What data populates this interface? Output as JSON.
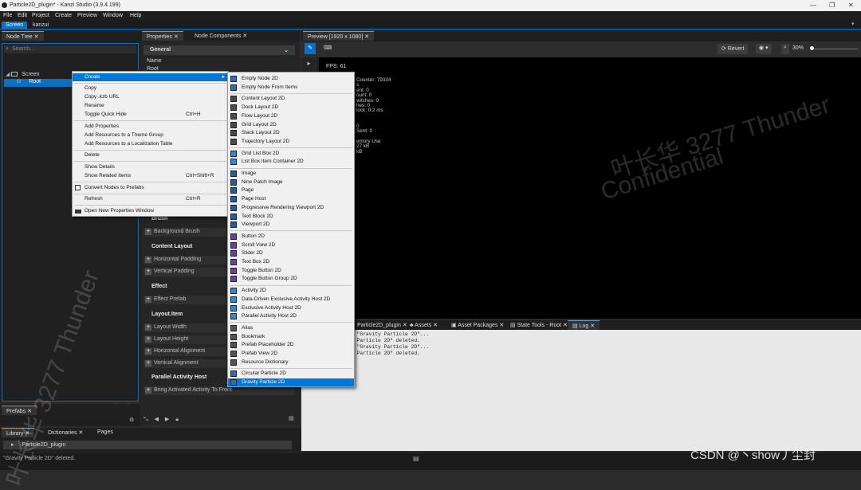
{
  "window": {
    "title": "Particle2D_plugin* - Kanzi Studio (3.9.4.199)",
    "minimize": "—",
    "maximize": "❐",
    "close": "✕"
  },
  "menu": [
    "File",
    "Edit",
    "Project",
    "Create",
    "Preview",
    "Window",
    "Help"
  ],
  "workspace_tabs": [
    "Screen",
    "kanzui"
  ],
  "node_tree": {
    "tab": "Node Tree",
    "search_placeholder": "Search...",
    "screen": "Screen",
    "root": "Root"
  },
  "properties": {
    "tab1": "Properties",
    "tab2": "Node Components",
    "section": "General",
    "name_label": "Name",
    "name_value": "Root",
    "sections": [
      {
        "title": "Brush",
        "items": [
          "Background Brush"
        ]
      },
      {
        "title": "Content Layout",
        "items": [
          "Horizontal Padding",
          "Vertical Padding"
        ]
      },
      {
        "title": "Effect",
        "items": [
          "Effect Prefab"
        ]
      },
      {
        "title": "Layout.Item",
        "items": [
          "Layout Width",
          "Layout Height",
          "Horizontal Alignment",
          "Vertical Alignment"
        ]
      },
      {
        "title": "Parallel Activity Host",
        "items": [
          "Bring Activated Activity To Front"
        ]
      }
    ]
  },
  "preview": {
    "tab": "Preview [1920 x 1080]",
    "revert": "Revert",
    "zoom": "30%",
    "fps": "FPS: 61",
    "stats": [
      "Counter: 79334",
      "s",
      "ent: 0",
      "ount: 0",
      "witches: 0",
      "hes: 0",
      "lock: 0.2 ms",
      "",
      "",
      "0",
      "Sent: 0",
      "",
      "emory Use",
      "27 kB",
      "kB"
    ]
  },
  "bottom_tabs": [
    "Particle2D_plugin",
    "Assets",
    "Asset Packages",
    "State Tools - Root",
    "Log"
  ],
  "log": [
    "y \"Gravity Particle 2D\"...",
    "y Particle 2D\" deleted.",
    "y \"Gravity Particle 2D\"...",
    "y Particle 2D\" deleted."
  ],
  "prefabs": {
    "tab": "Prefabs"
  },
  "library": {
    "tabs": [
      "Library",
      "Dictionaries",
      "Pages"
    ],
    "item": "Particle2D_plugin"
  },
  "status": "\"Gravity Particle 2D\" deleted.",
  "context_menu": {
    "groups": [
      [
        "Create"
      ],
      [
        "Copy",
        "Copy .kzb URL",
        "Rename",
        "Toggle Quick Hide"
      ],
      [
        "Add Properties",
        "Add Resources to a Theme Group",
        "Add Resources to a Localization Table"
      ],
      [
        "Delete"
      ],
      [
        "Show Details",
        "Show Related Items"
      ],
      [
        "Convert Nodes to Prefabs"
      ],
      [
        "Refresh"
      ],
      [
        "Open New Properties Window"
      ]
    ],
    "shortcuts": {
      "Toggle Quick Hide": "Ctrl+H",
      "Show Related Items": "Ctrl+Shift+R",
      "Refresh": "Ctrl+R"
    }
  },
  "create_menu": {
    "groups": [
      [
        "Empty Node 2D",
        "Empty Node From Items"
      ],
      [
        "Content Layout 2D",
        "Dock Layout 2D",
        "Flow Layout 2D",
        "Grid Layout 2D",
        "Stack Layout 2D",
        "Trajectory Layout 2D"
      ],
      [
        "Grid List Box 2D",
        "List Box Item Container 2D"
      ],
      [
        "Image",
        "Nine Patch Image",
        "Page",
        "Page Host",
        "Progressive Rendering Viewport 2D",
        "Text Block 2D",
        "Viewport 2D"
      ],
      [
        "Button 2D",
        "Scroll View 2D",
        "Slider 2D",
        "Text Box 2D",
        "Toggle Button 2D",
        "Toggle Button Group 2D"
      ],
      [
        "Activity 2D",
        "Data-Driven Exclusive Activity Host 2D",
        "Exclusive Activity Host 2D",
        "Parallel Activity Host 2D"
      ],
      [
        "Alias",
        "Bookmark",
        "Prefab Placeholder 2D",
        "Prefab View 2D",
        "Resource Dictionary"
      ],
      [
        "Circular Particle 2D",
        "Gravity Particle 2D"
      ]
    ],
    "highlighted": "Gravity Particle 2D"
  },
  "watermarks": {
    "name": "叶长华 3277 Thunder",
    "confidential": "Confidential",
    "csdn": "CSDN @丶show丿尘封"
  },
  "colors": {
    "accent": "#0e70c0",
    "menu_bg": "#f0f0f0",
    "highlight": "#0078d7"
  }
}
